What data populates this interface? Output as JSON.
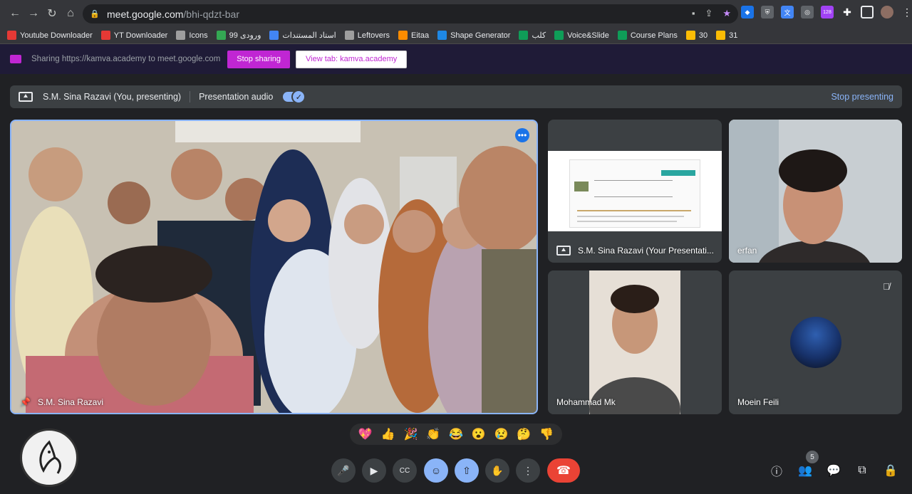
{
  "browser": {
    "url_host": "meet.google.com",
    "url_path": "/bhi-qdzt-bar",
    "badge_count": "128"
  },
  "bookmarks": [
    {
      "label": "Youtube Downloader",
      "color": "#e53935"
    },
    {
      "label": "YT Downloader",
      "color": "#e53935"
    },
    {
      "label": "Icons",
      "color": "#9e9e9e"
    },
    {
      "label": "ورودی 99",
      "color": "#34a853"
    },
    {
      "label": "استاد المستندات",
      "color": "#4285f4"
    },
    {
      "label": "Leftovers",
      "color": "#9e9e9e"
    },
    {
      "label": "Eitaa",
      "color": "#fb8c00"
    },
    {
      "label": "Shape Generator",
      "color": "#1e88e5"
    },
    {
      "label": "کلب",
      "color": "#0f9d58"
    },
    {
      "label": "Voice&Slide",
      "color": "#0f9d58"
    },
    {
      "label": "Course Plans",
      "color": "#0f9d58"
    },
    {
      "label": "30",
      "color": "#fbbc05"
    },
    {
      "label": "31",
      "color": "#fbbc05"
    }
  ],
  "sharing": {
    "text": "Sharing https://kamva.academy to meet.google.com",
    "stop_label": "Stop sharing",
    "view_label": "View tab: kamva.academy"
  },
  "presenting": {
    "who": "S.M. Sina Razavi (You, presenting)",
    "audio_label": "Presentation audio",
    "stop_label": "Stop presenting"
  },
  "tiles": {
    "main_name": "S.M. Sina Razavi",
    "presentation_name": "S.M. Sina Razavi (Your Presentati...",
    "erfan_name": "erfan",
    "mohammad_name": "Mohammad Mk",
    "moein_name": "Moein Feili"
  },
  "reactions": [
    "💖",
    "👍",
    "🎉",
    "👏",
    "😂",
    "😮",
    "😢",
    "🤔",
    "👎"
  ],
  "participants_count": "5"
}
